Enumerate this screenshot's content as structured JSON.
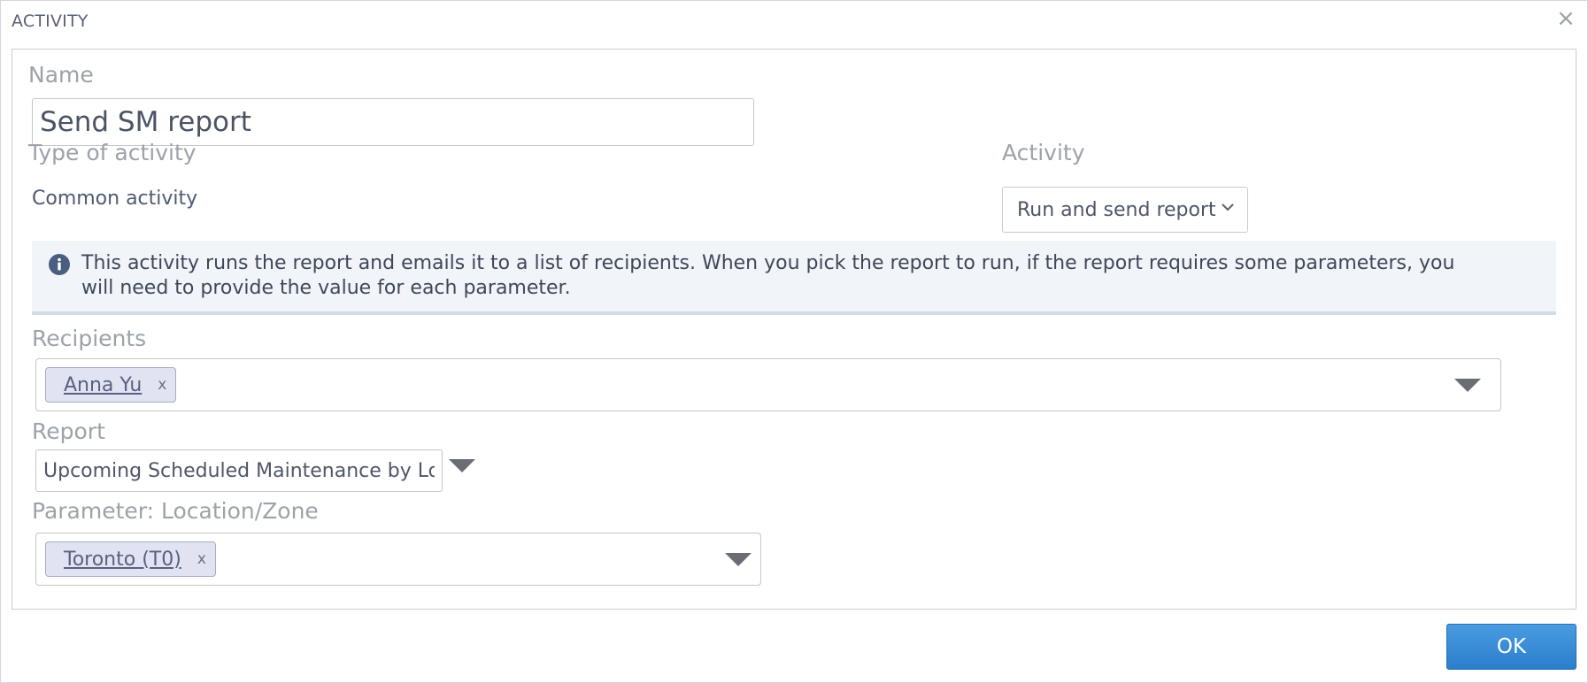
{
  "dialog": {
    "title": "ACTIVITY",
    "close_glyph": "×",
    "ok_label": "OK"
  },
  "form": {
    "name_label": "Name",
    "name_value": "Send SM report",
    "type_label": "Type of activity",
    "type_value": "Common activity",
    "activity_label": "Activity",
    "activity_value": "Run and send report",
    "info_text": "This activity runs the report and emails it to a list of recipients. When you pick the report to run, if the report requires some parameters, you will need to provide the value for each parameter.",
    "recipients_label": "Recipients",
    "recipients": [
      {
        "label": "Anna Yu",
        "remove": "x"
      }
    ],
    "report_label": "Report",
    "report_value": "Upcoming Scheduled Maintenance by Loc",
    "parameter_label": "Parameter: Location/Zone",
    "parameter_values": [
      {
        "label": "Toronto (T0)",
        "remove": "x"
      }
    ]
  },
  "icons": {
    "info": "info-circle-icon",
    "activity_dropdown": "chevron-down-icon",
    "dropdown_arrow": "caret-down-icon",
    "close": "close-icon"
  },
  "colors": {
    "primary_button": "#2f86d2",
    "tag_background": "#e1e3f2",
    "info_background": "#f1f5f9",
    "info_icon": "#4a5e80"
  }
}
